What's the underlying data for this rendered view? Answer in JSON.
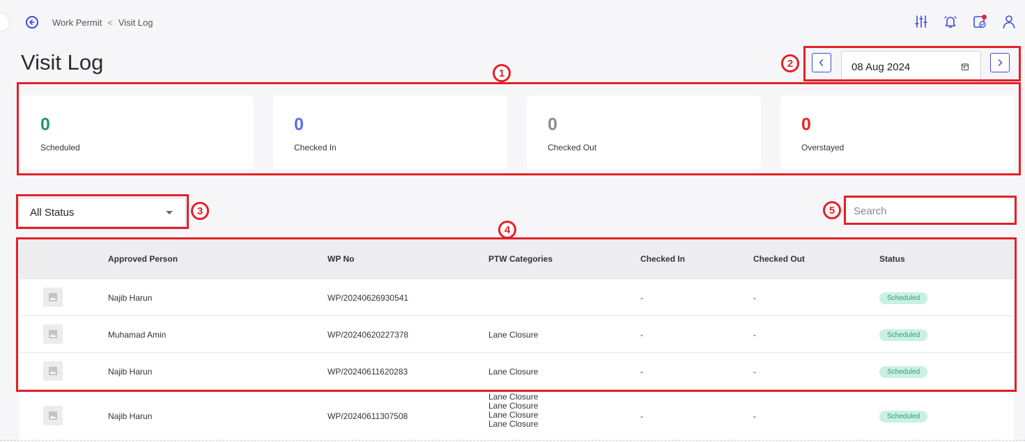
{
  "breadcrumb": {
    "parent": "Work Permit",
    "separator": "<",
    "current": "Visit Log"
  },
  "page_title": "Visit Log",
  "date_nav": {
    "date": "08 Aug 2024"
  },
  "stats": [
    {
      "value": "0",
      "label": "Scheduled",
      "color": "#1e9473"
    },
    {
      "value": "0",
      "label": "Checked In",
      "color": "#5a6cf0"
    },
    {
      "value": "0",
      "label": "Checked Out",
      "color": "#8c8c8c"
    },
    {
      "value": "0",
      "label": "Overstayed",
      "color": "#e8242b"
    }
  ],
  "filter": {
    "selected": "All Status"
  },
  "search": {
    "placeholder": "Search"
  },
  "table": {
    "headers": [
      "Approved Person",
      "WP No",
      "PTW Categories",
      "Checked In",
      "Checked Out",
      "Status"
    ],
    "rows": [
      {
        "person": "Najib Harun",
        "wp_no": "WP/20240626930541",
        "categories": "",
        "checked_in": "-",
        "checked_out": "-",
        "status": "Scheduled"
      },
      {
        "person": "Muhamad Amin",
        "wp_no": "WP/20240620227378",
        "categories": "Lane Closure",
        "checked_in": "-",
        "checked_out": "-",
        "status": "Scheduled"
      },
      {
        "person": "Najib Harun",
        "wp_no": "WP/20240611620283",
        "categories": "Lane Closure",
        "checked_in": "-",
        "checked_out": "-",
        "status": "Scheduled"
      },
      {
        "person": "Najib Harun",
        "wp_no": "WP/20240611307508",
        "categories_list": [
          "Lane Closure",
          "Lane Closure",
          "Lane Closure",
          "Lane Closure"
        ],
        "checked_in": "-",
        "checked_out": "-",
        "status": "Scheduled"
      }
    ]
  },
  "annotations": [
    "1",
    "2",
    "3",
    "4",
    "5"
  ],
  "colors": {
    "accent": "#3b4bd8",
    "annotation": "#e32027",
    "badge_bg": "#c9f0e4",
    "badge_text": "#2e9d7a"
  }
}
